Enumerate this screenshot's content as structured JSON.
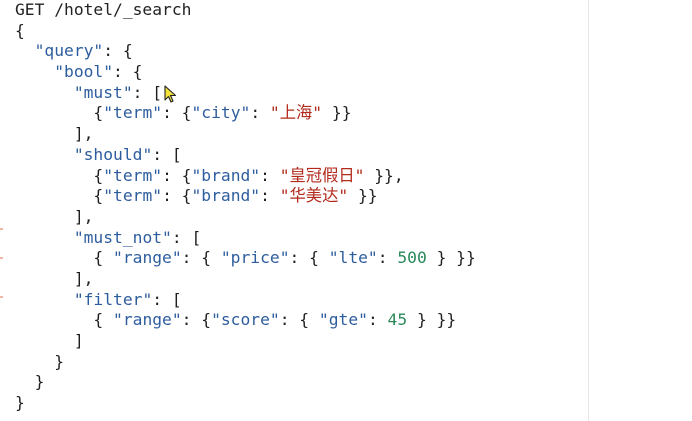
{
  "editor": {
    "request_line": "GET /hotel/_search",
    "lines": [
      {
        "indent": "",
        "parts": [
          {
            "t": "{",
            "c": "punct"
          }
        ]
      },
      {
        "indent": "  ",
        "parts": [
          {
            "t": "\"query\"",
            "c": "key"
          },
          {
            "t": ": {",
            "c": "punct"
          }
        ]
      },
      {
        "indent": "    ",
        "parts": [
          {
            "t": "\"bool\"",
            "c": "key"
          },
          {
            "t": ": {",
            "c": "punct"
          }
        ]
      },
      {
        "indent": "      ",
        "parts": [
          {
            "t": "\"must\"",
            "c": "key"
          },
          {
            "t": ": [",
            "c": "punct"
          }
        ]
      },
      {
        "indent": "        ",
        "parts": [
          {
            "t": "{",
            "c": "punct"
          },
          {
            "t": "\"term\"",
            "c": "key"
          },
          {
            "t": ": {",
            "c": "punct"
          },
          {
            "t": "\"city\"",
            "c": "key"
          },
          {
            "t": ": ",
            "c": "punct"
          },
          {
            "t": "\"上海\"",
            "c": "cn"
          },
          {
            "t": " }}",
            "c": "punct"
          }
        ]
      },
      {
        "indent": "      ",
        "parts": [
          {
            "t": "],",
            "c": "punct"
          }
        ]
      },
      {
        "indent": "      ",
        "parts": [
          {
            "t": "\"should\"",
            "c": "key"
          },
          {
            "t": ": [",
            "c": "punct"
          }
        ]
      },
      {
        "indent": "        ",
        "parts": [
          {
            "t": "{",
            "c": "punct"
          },
          {
            "t": "\"term\"",
            "c": "key"
          },
          {
            "t": ": {",
            "c": "punct"
          },
          {
            "t": "\"brand\"",
            "c": "key"
          },
          {
            "t": ": ",
            "c": "punct"
          },
          {
            "t": "\"皇冠假日\"",
            "c": "cn"
          },
          {
            "t": " }},",
            "c": "punct"
          }
        ]
      },
      {
        "indent": "        ",
        "parts": [
          {
            "t": "{",
            "c": "punct"
          },
          {
            "t": "\"term\"",
            "c": "key"
          },
          {
            "t": ": {",
            "c": "punct"
          },
          {
            "t": "\"brand\"",
            "c": "key"
          },
          {
            "t": ": ",
            "c": "punct"
          },
          {
            "t": "\"华美达\"",
            "c": "cn"
          },
          {
            "t": " }}",
            "c": "punct"
          }
        ]
      },
      {
        "indent": "      ",
        "parts": [
          {
            "t": "],",
            "c": "punct"
          }
        ]
      },
      {
        "indent": "      ",
        "parts": [
          {
            "t": "\"must_not\"",
            "c": "key"
          },
          {
            "t": ": [",
            "c": "punct"
          }
        ]
      },
      {
        "indent": "        ",
        "parts": [
          {
            "t": "{ ",
            "c": "punct"
          },
          {
            "t": "\"range\"",
            "c": "key"
          },
          {
            "t": ": { ",
            "c": "punct"
          },
          {
            "t": "\"price\"",
            "c": "key"
          },
          {
            "t": ": { ",
            "c": "punct"
          },
          {
            "t": "\"lte\"",
            "c": "key"
          },
          {
            "t": ": ",
            "c": "punct"
          },
          {
            "t": "500",
            "c": "num"
          },
          {
            "t": " } }}",
            "c": "punct"
          }
        ]
      },
      {
        "indent": "      ",
        "parts": [
          {
            "t": "],",
            "c": "punct"
          }
        ]
      },
      {
        "indent": "      ",
        "parts": [
          {
            "t": "\"filter\"",
            "c": "key"
          },
          {
            "t": ": [",
            "c": "punct"
          }
        ]
      },
      {
        "indent": "        ",
        "parts": [
          {
            "t": "{ ",
            "c": "punct"
          },
          {
            "t": "\"range\"",
            "c": "key"
          },
          {
            "t": ": {",
            "c": "punct"
          },
          {
            "t": "\"score\"",
            "c": "key"
          },
          {
            "t": ": { ",
            "c": "punct"
          },
          {
            "t": "\"gte\"",
            "c": "key"
          },
          {
            "t": ": ",
            "c": "punct"
          },
          {
            "t": "45",
            "c": "num"
          },
          {
            "t": " } }}",
            "c": "punct"
          }
        ]
      },
      {
        "indent": "      ",
        "parts": [
          {
            "t": "]",
            "c": "punct"
          }
        ]
      },
      {
        "indent": "    ",
        "parts": [
          {
            "t": "}",
            "c": "punct"
          }
        ]
      },
      {
        "indent": "  ",
        "parts": [
          {
            "t": "}",
            "c": "punct"
          }
        ]
      },
      {
        "indent": "",
        "parts": [
          {
            "t": "}",
            "c": "punct"
          }
        ]
      }
    ]
  },
  "colors": {
    "key": "#2e5d9e",
    "chinese_value": "#b22a1c",
    "number": "#2a8a5a",
    "punctuation": "#1f1f1f"
  },
  "icons": {
    "cursor": "mouse-pointer-icon"
  }
}
